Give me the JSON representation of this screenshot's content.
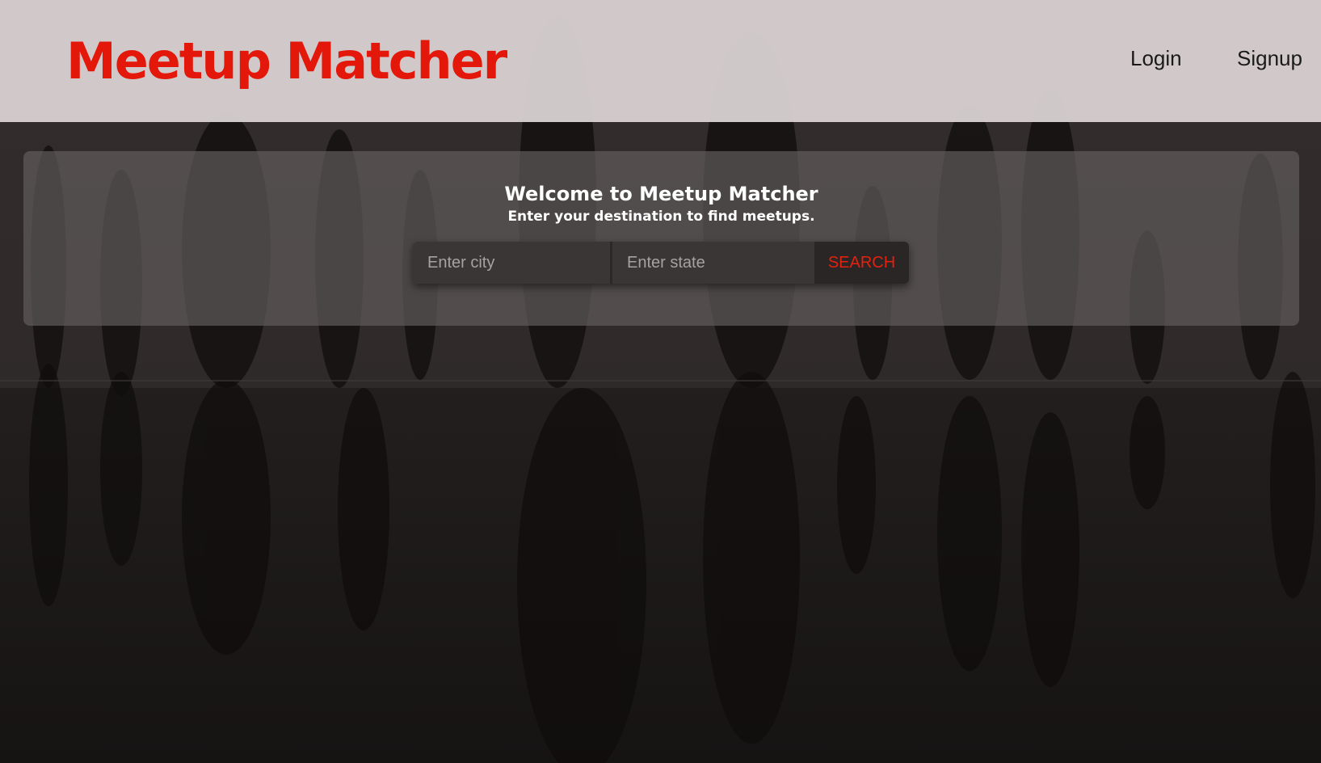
{
  "header": {
    "brand": "Meetup Matcher",
    "nav": {
      "login_label": "Login",
      "signup_label": "Signup"
    }
  },
  "hero": {
    "title": "Welcome to Meetup Matcher",
    "subtitle": "Enter your destination to find meetups.",
    "search": {
      "city_value": "",
      "city_placeholder": "Enter city",
      "state_value": "",
      "state_placeholder": "Enter state",
      "button_label": "SEARCH"
    }
  },
  "colors": {
    "brand_red": "#e3170a",
    "search_button_text": "#e3210d",
    "header_background": "#ded6d6",
    "panel_background": "#605a5a"
  }
}
